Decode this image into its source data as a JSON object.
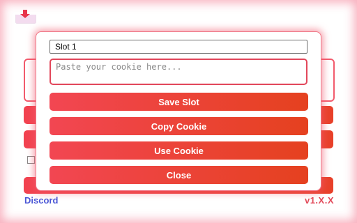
{
  "background": {
    "discord_link": "Discord",
    "version": "v1.X.X",
    "icon": "download-icon"
  },
  "modal": {
    "slot_name_value": "Slot 1",
    "cookie_placeholder": "Paste your cookie here...",
    "buttons": {
      "save": "Save Slot",
      "copy": "Copy Cookie",
      "use": "Use Cookie",
      "close": "Close"
    }
  },
  "colors": {
    "accent_start": "#f24652",
    "accent_end": "#e5411f",
    "border_accent": "#e2475b",
    "link": "#4a56d6",
    "version_text": "#e24a5a"
  }
}
